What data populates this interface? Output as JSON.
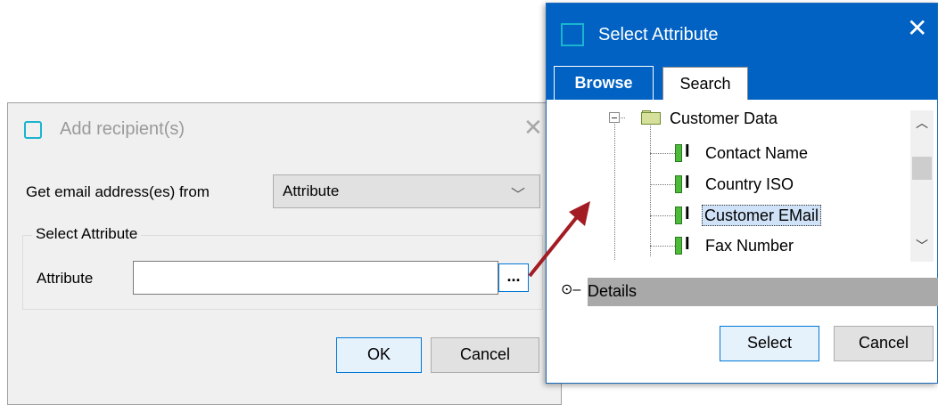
{
  "add_dialog": {
    "title": "Add recipient(s)",
    "close_glyph": "✕",
    "get_from_label": "Get email address(es) from",
    "get_from_value": "Attribute",
    "group_label": "Select Attribute",
    "attribute_label": "Attribute",
    "attribute_value": "",
    "browse_label": "...",
    "ok_label": "OK",
    "cancel_label": "Cancel"
  },
  "select_dialog": {
    "title": "Select Attribute",
    "close_glyph": "✕",
    "tabs": [
      {
        "label": "Browse",
        "active": true
      },
      {
        "label": "Search",
        "active": false
      }
    ],
    "tree": {
      "root": {
        "label": "Customer Data",
        "icon": "folder-icon",
        "expanded": true
      },
      "children": [
        {
          "label": "Contact Name",
          "icon": "attribute-icon",
          "selected": false
        },
        {
          "label": "Country ISO",
          "icon": "attribute-icon",
          "selected": false
        },
        {
          "label": "Customer EMail",
          "icon": "attribute-icon",
          "selected": true
        },
        {
          "label": "Fax Number",
          "icon": "attribute-icon",
          "selected": false
        }
      ]
    },
    "details_label": "Details",
    "select_label": "Select",
    "cancel_label": "Cancel"
  },
  "colors": {
    "titlebar": "#0162c4",
    "accent": "#0078d7",
    "annotation_arrow": "#a31c23"
  }
}
